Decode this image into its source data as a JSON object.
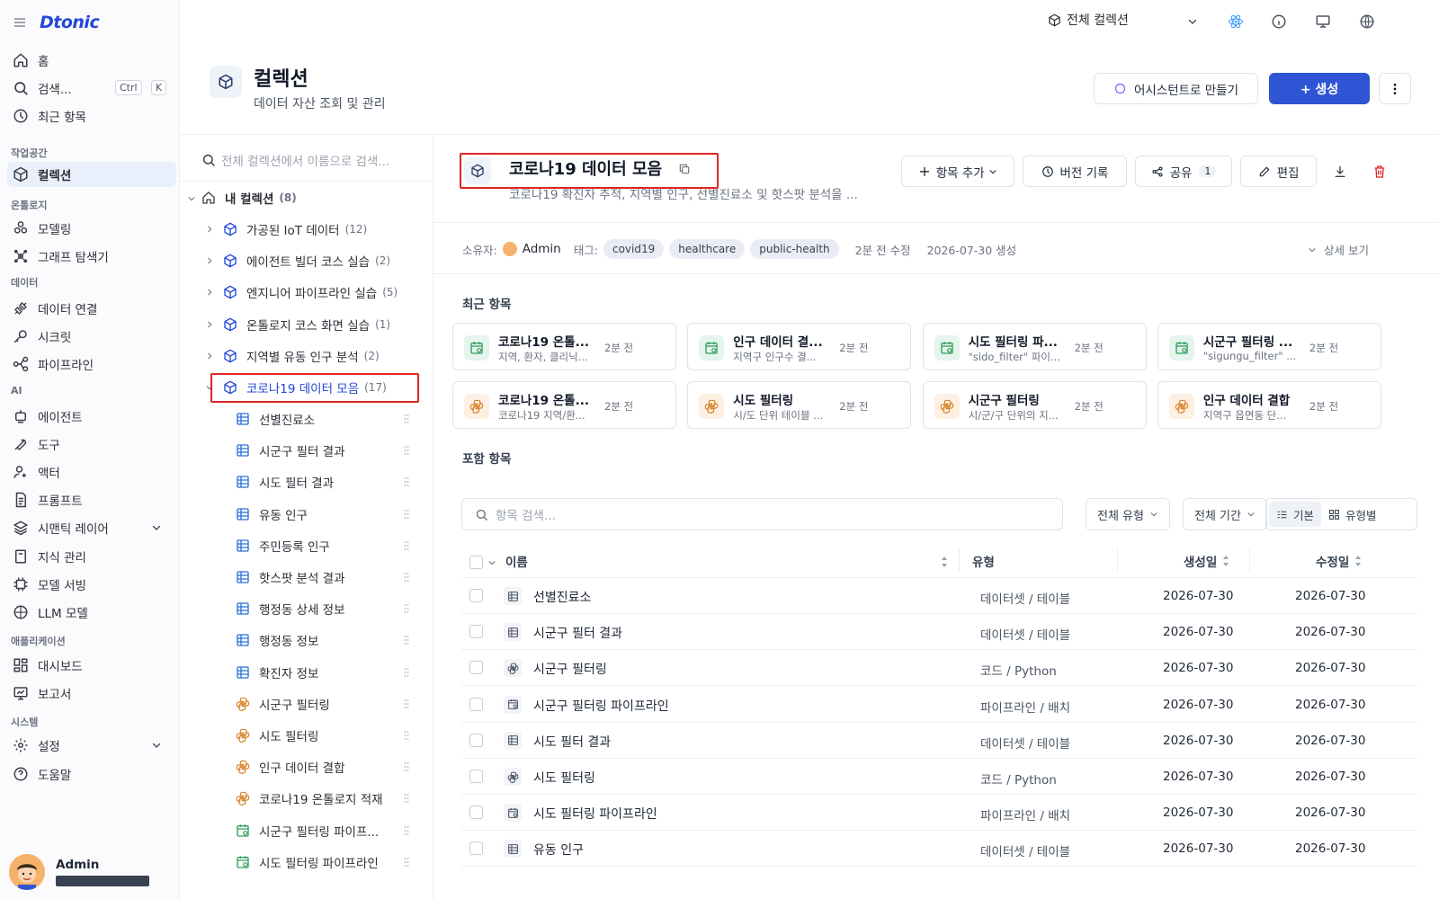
{
  "app": {
    "logo": "Dtonic"
  },
  "sidebar": {
    "home": "홈",
    "search": "검색...",
    "kbd_ctrl": "Ctrl",
    "kbd_k": "K",
    "recent": "최근 항목",
    "sec_workspace": "작업공간",
    "collection": "컬렉션",
    "sec_ontology": "온톨로지",
    "modeling": "모델링",
    "graph": "그래프 탐색기",
    "sec_data": "데이터",
    "data_conn": "데이터 연결",
    "secret": "시크릿",
    "pipeline": "파이프라인",
    "sec_ai": "AI",
    "agent": "에이전트",
    "tool": "도구",
    "actor": "액터",
    "prompt": "프롬프트",
    "semantic": "시맨틱 레이어",
    "knowledge": "지식 관리",
    "serving": "모델 서빙",
    "llm": "LLM 모델",
    "sec_app": "애플리케이션",
    "dashboard": "대시보드",
    "report": "보고서",
    "sec_system": "시스템",
    "settings": "설정",
    "help": "도움말",
    "user": "Admin"
  },
  "topbar": {
    "collection_select": "전체 컬렉션"
  },
  "header": {
    "title": "컬렉션",
    "subtitle": "데이터 자산 조회 및 관리",
    "assistant_btn": "어시스턴트로 만들기",
    "create_btn": "+ 생성"
  },
  "tree": {
    "search_placeholder": "전체 컬렉션에서 이름으로 검색...",
    "root": "내 컬렉션",
    "root_count": "(8)",
    "collections": [
      {
        "label": "가공된 IoT 데이터",
        "count": "(12)"
      },
      {
        "label": "에이전트 빌더 코스 실습",
        "count": "(2)"
      },
      {
        "label": "엔지니어 파이프라인 실습",
        "count": "(5)"
      },
      {
        "label": "온톨로지 코스 화면 실습",
        "count": "(1)"
      },
      {
        "label": "지역별 유동 인구 분석",
        "count": "(2)"
      },
      {
        "label": "코로나19 데이터 모음",
        "count": "(17)"
      }
    ],
    "items": [
      {
        "label": "선별진료소",
        "kind": "table"
      },
      {
        "label": "시군구 필터 결과",
        "kind": "table"
      },
      {
        "label": "시도 필터 결과",
        "kind": "table"
      },
      {
        "label": "유동 인구",
        "kind": "table"
      },
      {
        "label": "주민등록 인구",
        "kind": "table"
      },
      {
        "label": "핫스팟 분석 결과",
        "kind": "table"
      },
      {
        "label": "행정동 상세 정보",
        "kind": "table"
      },
      {
        "label": "행정동 정보",
        "kind": "table"
      },
      {
        "label": "확진자 정보",
        "kind": "table"
      },
      {
        "label": "시군구 필터링",
        "kind": "python"
      },
      {
        "label": "시도 필터링",
        "kind": "python"
      },
      {
        "label": "인구 데이터 결합",
        "kind": "python"
      },
      {
        "label": "코로나19 온톨로지 적재",
        "kind": "python"
      },
      {
        "label": "시군구 필터링 파이프...",
        "kind": "pipeline"
      },
      {
        "label": "시도 필터링 파이프라인",
        "kind": "pipeline"
      }
    ]
  },
  "detail": {
    "title": "코로나19 데이터 모음",
    "description": "코로나19 확진자 추적, 지역별 인구, 선별진료소 및 핫스팟 분석을 ...",
    "add_item": "항목 추가",
    "version": "버전 기록",
    "share": "공유",
    "share_count": "1",
    "edit": "편집",
    "owner_label": "소유자:",
    "owner": "Admin",
    "tags_label": "태그:",
    "tags": [
      "covid19",
      "healthcare",
      "public-health"
    ],
    "modified": "2분 전 수정",
    "created": "2026-07-30 생성",
    "details_toggle": "상세 보기",
    "recent_title": "최근 항목",
    "recent": [
      {
        "title": "코로나19 온톨...",
        "sub": "지역, 환자, 클리닉...",
        "time": "2분 전",
        "kind": "pipeline"
      },
      {
        "title": "인구 데이터 결...",
        "sub": "지역구 인구수 결...",
        "time": "2분 전",
        "kind": "pipeline"
      },
      {
        "title": "시도 필터링 파...",
        "sub": "\"sido_filter\" 파이...",
        "time": "2분 전",
        "kind": "pipeline"
      },
      {
        "title": "시군구 필터링 ...",
        "sub": "\"sigungu_filter\" ...",
        "time": "2분 전",
        "kind": "pipeline"
      },
      {
        "title": "코로나19 온톨...",
        "sub": "코로나19 지역/환...",
        "time": "2분 전",
        "kind": "python"
      },
      {
        "title": "시도 필터링",
        "sub": "시/도 단위 테이블 ...",
        "time": "2분 전",
        "kind": "python"
      },
      {
        "title": "시군구 필터링",
        "sub": "시/군/구 단위의 지...",
        "time": "2분 전",
        "kind": "python"
      },
      {
        "title": "인구 데이터 결합",
        "sub": "지역구 읍면동 단...",
        "time": "2분 전",
        "kind": "python"
      }
    ],
    "included_title": "포함 항목",
    "search_placeholder": "항목 검색...",
    "filter_type": "전체 유형",
    "filter_period": "전체 기간",
    "view_basic": "기본",
    "view_type": "유형별",
    "col_name": "이름",
    "col_type": "유형",
    "col_created": "생성일",
    "col_modified": "수정일",
    "rows": [
      {
        "name": "선별진료소",
        "type": "데이터셋 / 테이블",
        "created": "2026-07-30",
        "modified": "2026-07-30",
        "kind": "table"
      },
      {
        "name": "시군구 필터 결과",
        "type": "데이터셋 / 테이블",
        "created": "2026-07-30",
        "modified": "2026-07-30",
        "kind": "table"
      },
      {
        "name": "시군구 필터링",
        "type": "코드 / Python",
        "created": "2026-07-30",
        "modified": "2026-07-30",
        "kind": "python"
      },
      {
        "name": "시군구 필터링 파이프라인",
        "type": "파이프라인 / 배치",
        "created": "2026-07-30",
        "modified": "2026-07-30",
        "kind": "pipeline"
      },
      {
        "name": "시도 필터 결과",
        "type": "데이터셋 / 테이블",
        "created": "2026-07-30",
        "modified": "2026-07-30",
        "kind": "table"
      },
      {
        "name": "시도 필터링",
        "type": "코드 / Python",
        "created": "2026-07-30",
        "modified": "2026-07-30",
        "kind": "python"
      },
      {
        "name": "시도 필터링 파이프라인",
        "type": "파이프라인 / 배치",
        "created": "2026-07-30",
        "modified": "2026-07-30",
        "kind": "pipeline"
      },
      {
        "name": "유동 인구",
        "type": "데이터셋 / 테이블",
        "created": "2026-07-30",
        "modified": "2026-07-30",
        "kind": "table"
      }
    ]
  },
  "colors": {
    "accent": "#2f55d4",
    "highlight": "#e02424",
    "table_icon": "#2a6fdb",
    "python_icon": "#d9822b",
    "pipeline_icon": "#2f9e5b"
  }
}
